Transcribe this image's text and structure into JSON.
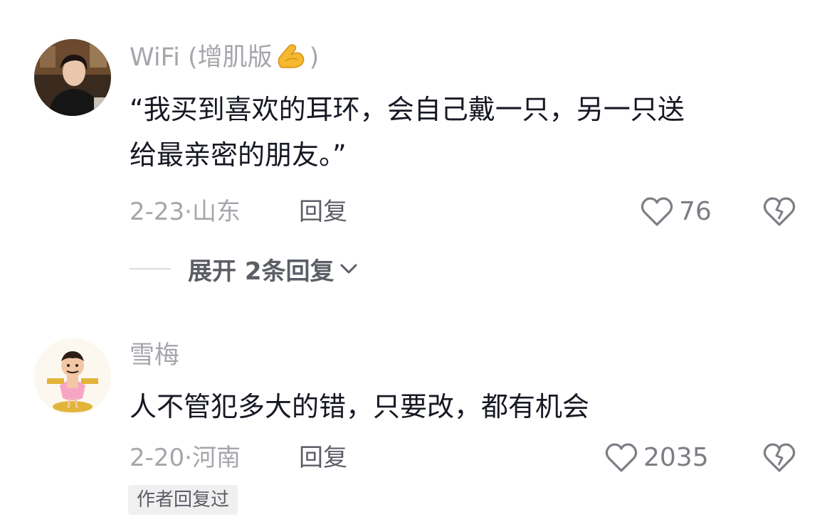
{
  "comments": [
    {
      "username": "WiFi (增肌版",
      "username_suffix": ")",
      "username_emoji": "flexed-biceps-emoji",
      "content_line1": "“我买到喜欢的耳环，会自己戴一只，另一只送",
      "content_line2": "给最亲密的朋友。”",
      "date": "2-23",
      "location": "山东",
      "reply_label": "回复",
      "likes": "76",
      "expand_label": "展开 2条回复",
      "avatar_icon": "user-avatar-photo"
    },
    {
      "username": "雪梅",
      "content": "人不管犯多大的错，只要改，都有机会",
      "date": "2-20",
      "location": "河南",
      "reply_label": "回复",
      "likes": "2035",
      "author_badge": "作者回复过",
      "avatar_icon": "cartoon-avatar"
    }
  ],
  "colors": {
    "primary_text": "#161823",
    "secondary_text": "#a5a6ab",
    "action_text": "#5c5e66",
    "badge_bg": "#f0f0f1"
  },
  "meta_separator": "·"
}
